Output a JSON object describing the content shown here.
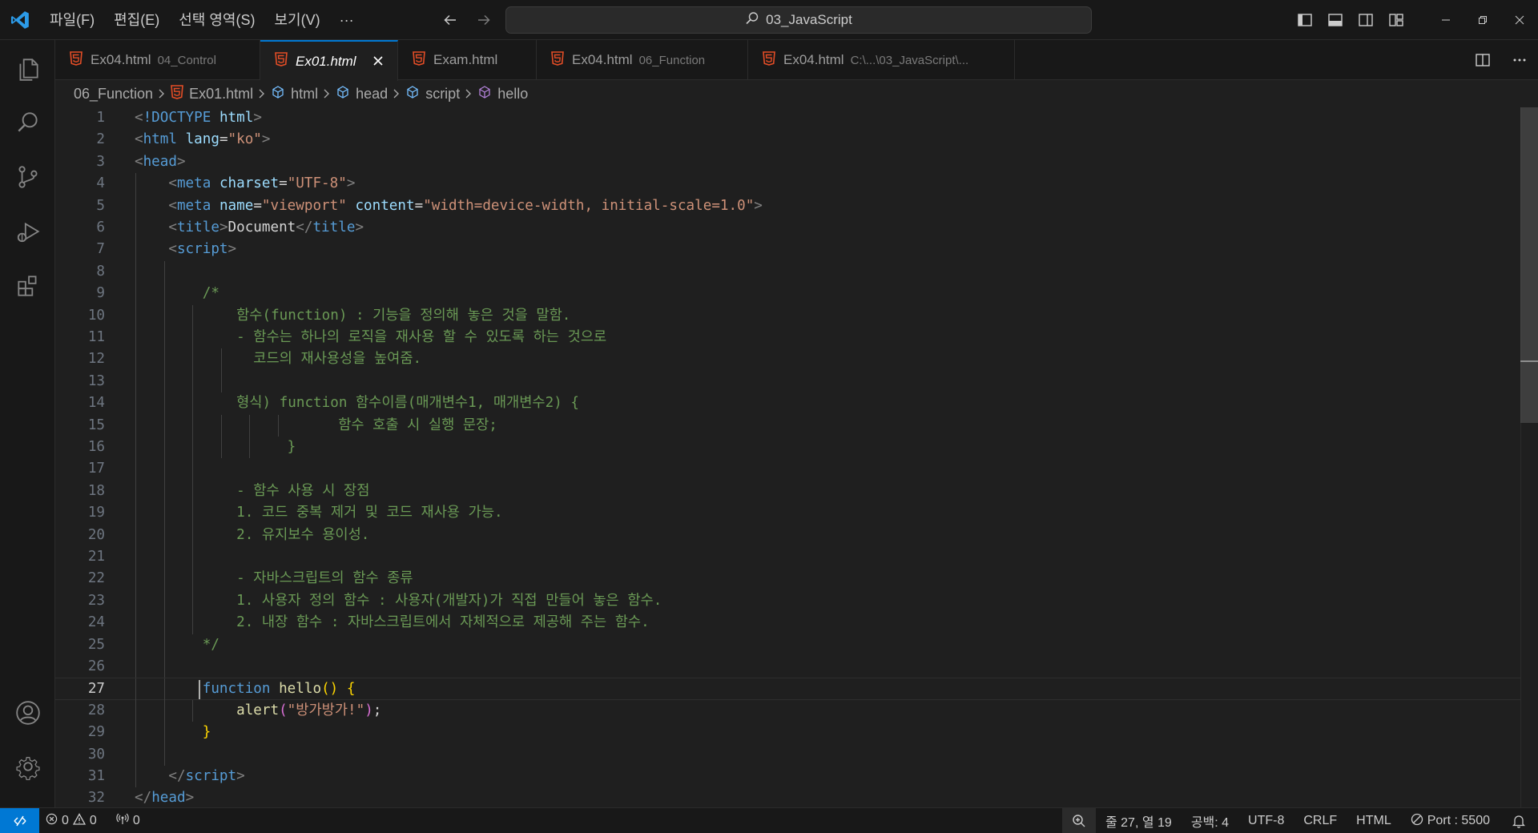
{
  "titlebar": {
    "menu": [
      "파일(F)",
      "편집(E)",
      "선택 영역(S)",
      "보기(V)"
    ],
    "more_label": "···",
    "search_text": "03_JavaScript"
  },
  "tabs": [
    {
      "name": "Ex04.html",
      "desc": "04_Control",
      "active": false
    },
    {
      "name": "Ex01.html",
      "desc": "",
      "active": true
    },
    {
      "name": "Exam.html",
      "desc": "",
      "active": false
    },
    {
      "name": "Ex04.html",
      "desc": "06_Function",
      "active": false
    },
    {
      "name": "Ex04.html",
      "desc": "C:\\...\\03_JavaScript\\...",
      "active": false
    }
  ],
  "breadcrumb": {
    "folder": "06_Function",
    "file": "Ex01.html",
    "html": "html",
    "head": "head",
    "script": "script",
    "func": "hello"
  },
  "editor": {
    "current_line": 27,
    "lines": [
      {
        "n": "1",
        "indent": 0,
        "tokens": [
          [
            "t-tag",
            "<"
          ],
          [
            "t-tn",
            "!DOCTYPE"
          ],
          [
            "t-tx",
            " "
          ],
          [
            "t-an",
            "html"
          ],
          [
            "t-tag",
            ">"
          ]
        ]
      },
      {
        "n": "2",
        "indent": 0,
        "tokens": [
          [
            "t-tag",
            "<"
          ],
          [
            "t-tn",
            "html"
          ],
          [
            "t-tx",
            " "
          ],
          [
            "t-an",
            "lang"
          ],
          [
            "t-tx",
            "="
          ],
          [
            "t-av",
            "\"ko\""
          ],
          [
            "t-tag",
            ">"
          ]
        ]
      },
      {
        "n": "3",
        "indent": 0,
        "tokens": [
          [
            "t-tag",
            "<"
          ],
          [
            "t-tn",
            "head"
          ],
          [
            "t-tag",
            ">"
          ]
        ]
      },
      {
        "n": "4",
        "indent": 1,
        "tokens": [
          [
            "t-tx",
            "    "
          ],
          [
            "t-tag",
            "<"
          ],
          [
            "t-tn",
            "meta"
          ],
          [
            "t-tx",
            " "
          ],
          [
            "t-an",
            "charset"
          ],
          [
            "t-tx",
            "="
          ],
          [
            "t-av",
            "\"UTF-8\""
          ],
          [
            "t-tag",
            ">"
          ]
        ]
      },
      {
        "n": "5",
        "indent": 1,
        "tokens": [
          [
            "t-tx",
            "    "
          ],
          [
            "t-tag",
            "<"
          ],
          [
            "t-tn",
            "meta"
          ],
          [
            "t-tx",
            " "
          ],
          [
            "t-an",
            "name"
          ],
          [
            "t-tx",
            "="
          ],
          [
            "t-av",
            "\"viewport\""
          ],
          [
            "t-tx",
            " "
          ],
          [
            "t-an",
            "content"
          ],
          [
            "t-tx",
            "="
          ],
          [
            "t-av",
            "\"width=device-width, initial-scale=1.0\""
          ],
          [
            "t-tag",
            ">"
          ]
        ]
      },
      {
        "n": "6",
        "indent": 1,
        "tokens": [
          [
            "t-tx",
            "    "
          ],
          [
            "t-tag",
            "<"
          ],
          [
            "t-tn",
            "title"
          ],
          [
            "t-tag",
            ">"
          ],
          [
            "t-tx",
            "Document"
          ],
          [
            "t-tag",
            "</"
          ],
          [
            "t-tn",
            "title"
          ],
          [
            "t-tag",
            ">"
          ]
        ]
      },
      {
        "n": "7",
        "indent": 1,
        "tokens": [
          [
            "t-tx",
            "    "
          ],
          [
            "t-tag",
            "<"
          ],
          [
            "t-tn",
            "script"
          ],
          [
            "t-tag",
            ">"
          ]
        ]
      },
      {
        "n": "8",
        "indent": 2,
        "tokens": []
      },
      {
        "n": "9",
        "indent": 2,
        "tokens": [
          [
            "t-tx",
            "        "
          ],
          [
            "t-cm",
            "/*"
          ]
        ]
      },
      {
        "n": "10",
        "indent": 3,
        "tokens": [
          [
            "t-tx",
            "            "
          ],
          [
            "t-cm",
            "함수(function) : 기능을 정의해 놓은 것을 말함."
          ]
        ]
      },
      {
        "n": "11",
        "indent": 3,
        "tokens": [
          [
            "t-tx",
            "            "
          ],
          [
            "t-cm",
            "- 함수는 하나의 로직을 재사용 할 수 있도록 하는 것으로"
          ]
        ]
      },
      {
        "n": "12",
        "indent": 4,
        "tokens": [
          [
            "t-tx",
            "              "
          ],
          [
            "t-cm",
            "코드의 재사용성을 높여줌."
          ]
        ]
      },
      {
        "n": "13",
        "indent": 4,
        "tokens": []
      },
      {
        "n": "14",
        "indent": 3,
        "tokens": [
          [
            "t-tx",
            "            "
          ],
          [
            "t-cm",
            "형식) function 함수이름(매개변수1, 매개변수2) {"
          ]
        ]
      },
      {
        "n": "15",
        "indent": 6,
        "tokens": [
          [
            "t-tx",
            "                        "
          ],
          [
            "t-cm",
            "함수 호출 시 실행 문장;"
          ]
        ]
      },
      {
        "n": "16",
        "indent": 5,
        "tokens": [
          [
            "t-tx",
            "                  "
          ],
          [
            "t-cm",
            "}"
          ]
        ]
      },
      {
        "n": "17",
        "indent": 3,
        "tokens": []
      },
      {
        "n": "18",
        "indent": 3,
        "tokens": [
          [
            "t-tx",
            "            "
          ],
          [
            "t-cm",
            "- 함수 사용 시 장점"
          ]
        ]
      },
      {
        "n": "19",
        "indent": 3,
        "tokens": [
          [
            "t-tx",
            "            "
          ],
          [
            "t-cm",
            "1. 코드 중복 제거 및 코드 재사용 가능."
          ]
        ]
      },
      {
        "n": "20",
        "indent": 3,
        "tokens": [
          [
            "t-tx",
            "            "
          ],
          [
            "t-cm",
            "2. 유지보수 용이성."
          ]
        ]
      },
      {
        "n": "21",
        "indent": 3,
        "tokens": []
      },
      {
        "n": "22",
        "indent": 3,
        "tokens": [
          [
            "t-tx",
            "            "
          ],
          [
            "t-cm",
            "- 자바스크립트의 함수 종류"
          ]
        ]
      },
      {
        "n": "23",
        "indent": 3,
        "tokens": [
          [
            "t-tx",
            "            "
          ],
          [
            "t-cm",
            "1. 사용자 정의 함수 : 사용자(개발자)가 직접 만들어 놓은 함수."
          ]
        ]
      },
      {
        "n": "24",
        "indent": 3,
        "tokens": [
          [
            "t-tx",
            "            "
          ],
          [
            "t-cm",
            "2. 내장 함수 : 자바스크립트에서 자체적으로 제공해 주는 함수."
          ]
        ]
      },
      {
        "n": "25",
        "indent": 2,
        "tokens": [
          [
            "t-tx",
            "        "
          ],
          [
            "t-cm",
            "*/"
          ]
        ]
      },
      {
        "n": "26",
        "indent": 2,
        "tokens": []
      },
      {
        "n": "27",
        "indent": 2,
        "tokens": [
          [
            "t-tx",
            "        "
          ],
          [
            "t-kw",
            "function"
          ],
          [
            "t-tx",
            " "
          ],
          [
            "t-fn",
            "hello"
          ],
          [
            "t-br",
            "()"
          ],
          [
            "t-tx",
            " "
          ],
          [
            "t-br",
            "{"
          ]
        ]
      },
      {
        "n": "28",
        "indent": 3,
        "tokens": [
          [
            "t-tx",
            "            "
          ],
          [
            "t-fn",
            "alert"
          ],
          [
            "t-br2",
            "("
          ],
          [
            "t-str",
            "\"방가방가!\""
          ],
          [
            "t-br2",
            ")"
          ],
          [
            "t-pn",
            ";"
          ]
        ]
      },
      {
        "n": "29",
        "indent": 2,
        "tokens": [
          [
            "t-tx",
            "        "
          ],
          [
            "t-br",
            "}"
          ]
        ]
      },
      {
        "n": "30",
        "indent": 2,
        "tokens": []
      },
      {
        "n": "31",
        "indent": 1,
        "tokens": [
          [
            "t-tx",
            "    "
          ],
          [
            "t-tag",
            "</"
          ],
          [
            "t-tn",
            "script"
          ],
          [
            "t-tag",
            ">"
          ]
        ]
      },
      {
        "n": "32",
        "indent": 0,
        "tokens": [
          [
            "t-tag",
            "</"
          ],
          [
            "t-tn",
            "head"
          ],
          [
            "t-tag",
            ">"
          ]
        ]
      }
    ]
  },
  "statusbar": {
    "errors": "0",
    "warnings": "0",
    "ports_open": "0",
    "cursor_pos": "줄 27, 열 19",
    "indent": "공백: 4",
    "encoding": "UTF-8",
    "eol": "CRLF",
    "language": "HTML",
    "port": "Port : 5500"
  },
  "colors": {
    "accent": "#0078d4",
    "html_icon": "#e44d26",
    "background": "#1f1f1f"
  }
}
